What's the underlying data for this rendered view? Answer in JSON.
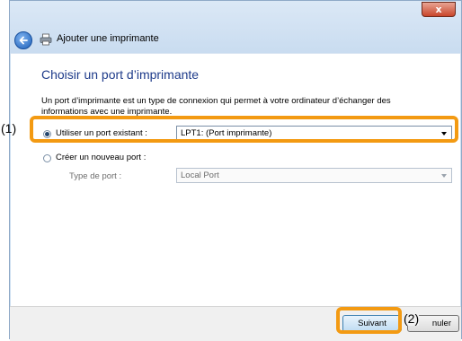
{
  "window": {
    "title": "Ajouter une imprimante",
    "close_label": "x"
  },
  "wizard": {
    "heading": "Choisir un port d’imprimante",
    "description": "Un port d’imprimante est un type de connexion qui permet à votre ordinateur d’échanger des informations avec une imprimante.",
    "existing_port": {
      "label": "Utiliser un port existant :",
      "selected": "LPT1: (Port imprimante)",
      "checked": true
    },
    "new_port": {
      "label": "Créer un nouveau port :",
      "type_label": "Type de port :",
      "selected": "Local Port",
      "checked": false
    }
  },
  "footer": {
    "next_label": "Suivant",
    "cancel_label": "Annuler",
    "cancel_visible_text": "nuler"
  },
  "callouts": {
    "one": "(1)",
    "two": "(2)"
  },
  "colors": {
    "highlight": "#f39a12",
    "heading": "#1e3b8a"
  }
}
